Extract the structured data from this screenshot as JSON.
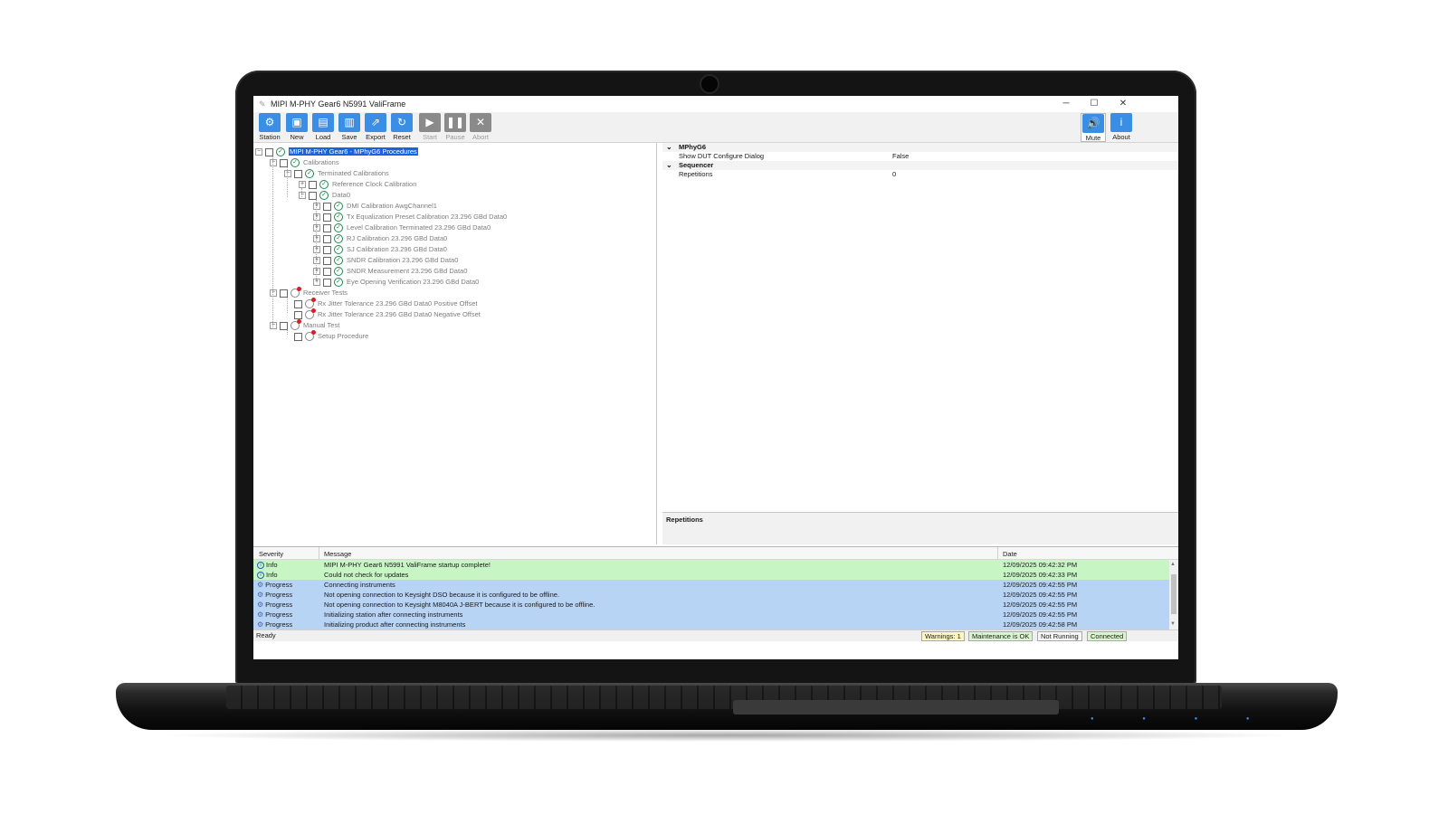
{
  "window": {
    "title": "MIPI M-PHY Gear6 N5991 ValiFrame",
    "minimize": "─",
    "maximize": "☐",
    "close": "✕"
  },
  "toolbar": {
    "station": "Station",
    "new": "New",
    "load": "Load",
    "save": "Save",
    "export": "Export",
    "reset": "Reset",
    "start": "Start",
    "pause": "Pause",
    "abort": "Abort",
    "mute": "Mute",
    "about": "About"
  },
  "tree": {
    "root": "MIPI M-PHY Gear6  -  MPhyG6 Procedures",
    "calibrations": "Calibrations",
    "terminated": "Terminated Calibrations",
    "ref_clock": "Reference Clock Calibration",
    "data0": "Data0",
    "items": [
      "DMI Calibration AwgChannel1",
      "Tx Equalization Preset Calibration 23.296 GBd Data0",
      "Level Calibration Terminated 23.296 GBd Data0",
      "RJ Calibration 23.296 GBd Data0",
      "SJ Calibration 23.296 GBd Data0",
      "SNDR Calibration 23.296 GBd Data0",
      "SNDR Measurement 23.296 GBd Data0",
      "Eye Opening Verification 23.296 GBd Data0"
    ],
    "receiver": "Receiver Tests",
    "rx_pos": "Rx Jitter Tolerance 23.296 GBd Data0 Positive Offset",
    "rx_neg": "Rx Jitter Tolerance 23.296 GBd Data0 Negative Offset",
    "manual": "Manual Test",
    "setup": "Setup Procedure"
  },
  "properties": {
    "cat1": "MPhyG6",
    "p1_name": "Show DUT Configure Dialog",
    "p1_value": "False",
    "cat2": "Sequencer",
    "p2_name": "Repetitions",
    "p2_value": "0",
    "description_title": "Repetitions"
  },
  "log": {
    "headers": {
      "severity": "Severity",
      "message": "Message",
      "date": "Date"
    },
    "rows": [
      {
        "severity": "Info",
        "message": "MIPI M-PHY Gear6 N5991 ValiFrame startup complete!",
        "date": "12/09/2025 09:42:32 PM"
      },
      {
        "severity": "Info",
        "message": "Could not check for updates",
        "date": "12/09/2025 09:42:33 PM"
      },
      {
        "severity": "Progress",
        "message": "Connecting instruments",
        "date": "12/09/2025 09:42:55 PM"
      },
      {
        "severity": "Progress",
        "message": "Not opening connection to Keysight DSO because it is configured to be offline.",
        "date": "12/09/2025 09:42:55 PM"
      },
      {
        "severity": "Progress",
        "message": "Not opening connection to Keysight M8040A J-BERT because it is configured to be offline.",
        "date": "12/09/2025 09:42:55 PM"
      },
      {
        "severity": "Progress",
        "message": "Initializing station after connecting instruments",
        "date": "12/09/2025 09:42:55 PM"
      },
      {
        "severity": "Progress",
        "message": "Initializing product after connecting instruments",
        "date": "12/09/2025 09:42:58 PM"
      }
    ]
  },
  "status": {
    "ready": "Ready",
    "warnings": "Warnings: 1",
    "maintenance": "Maintenance is OK",
    "running": "Not Running",
    "connected": "Connected"
  },
  "colors": {
    "accent_blue": "#3a8ee6",
    "selection": "#1a63d9",
    "info_row": "#c7f5c4",
    "progress_row": "#b8d4f5",
    "pass_green": "#1f8a4c",
    "warning_bg": "#fff6c2",
    "ok_bg": "#d9f5d0"
  }
}
